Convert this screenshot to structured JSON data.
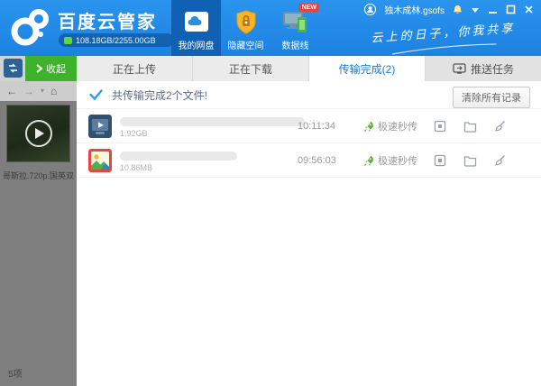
{
  "header": {
    "app_title": "百度云管家",
    "storage_text": "108.18GB/2255.00GB",
    "nav": [
      {
        "label": "我的网盘",
        "active": true
      },
      {
        "label": "隐藏空间",
        "active": false
      },
      {
        "label": "数据线",
        "active": false,
        "badge": "NEW"
      }
    ],
    "username": "独木成林.gsofs",
    "slogan": "云上的日子，你我共享"
  },
  "toolbar": {
    "collapse_label": "收起",
    "tabs": [
      {
        "label": "正在上传",
        "active": false
      },
      {
        "label": "正在下载",
        "active": false
      },
      {
        "label": "传输完成(2)",
        "active": true
      },
      {
        "label": "推送任务",
        "active": false
      }
    ]
  },
  "content": {
    "summary": "共传输完成2个文件!",
    "clear_button_label": "清除所有记录",
    "files": [
      {
        "type": "video",
        "size": "1.92GB",
        "time": "10:11:34",
        "badge": "极速秒传"
      },
      {
        "type": "image",
        "size": "10.86MB",
        "time": "09:56:03",
        "badge": "极速秒传"
      }
    ]
  },
  "sidebar": {
    "video_caption": "哥斯拉.720p.国英双",
    "items_count": "5项"
  },
  "icons": {
    "window": [
      "bell-icon",
      "chevron-down-icon",
      "minimize-icon",
      "maximize-icon",
      "close-icon"
    ],
    "row_actions": [
      "share-icon",
      "open-folder-icon",
      "broom-icon"
    ],
    "badge": "rocket-icon"
  },
  "colors": {
    "header_blue": "#1c82e0",
    "nav_active_blue": "#1061b4",
    "green_button": "#3fb22c",
    "accent_blue": "#1a7ad4",
    "badge_green": "#55b531",
    "new_badge_red": "#e6443c"
  }
}
